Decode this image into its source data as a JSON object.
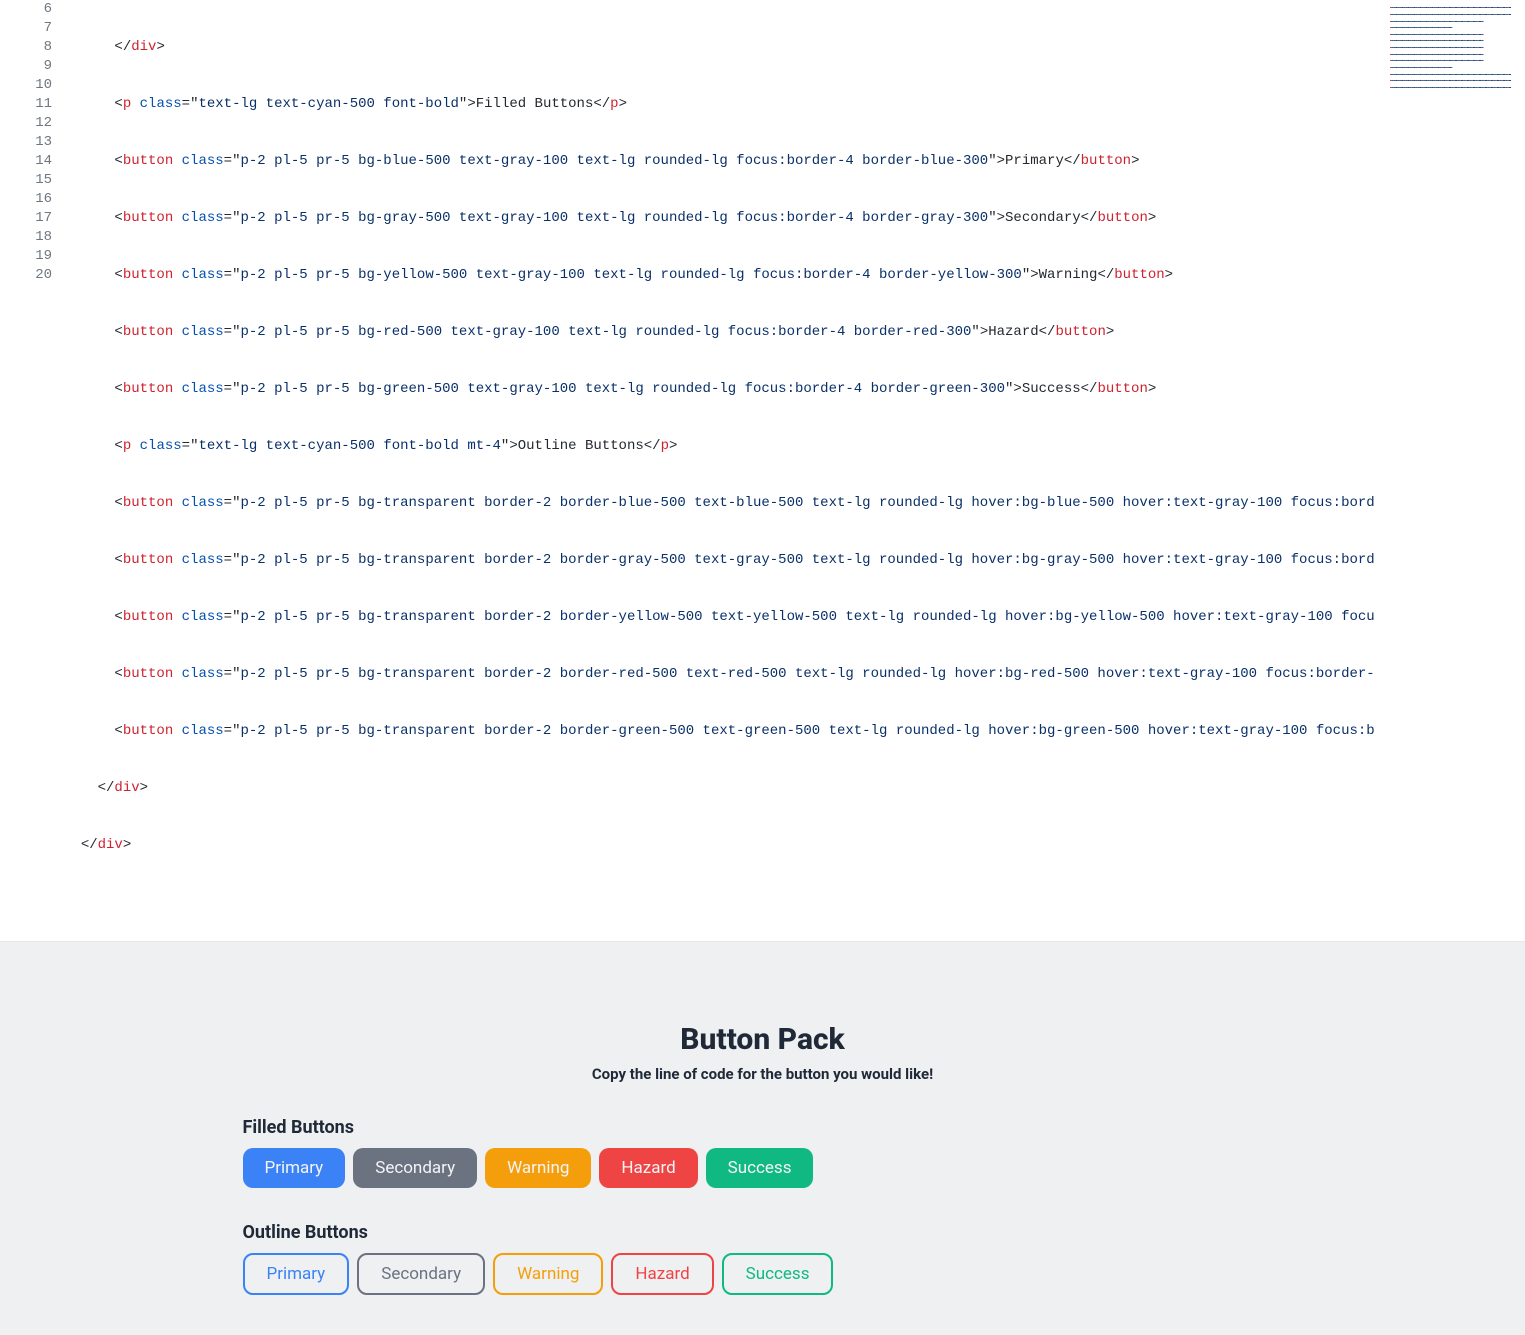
{
  "gutter": [
    "6",
    "7",
    "8",
    "9",
    "10",
    "11",
    "12",
    "13",
    "14",
    "15",
    "16",
    "17",
    "18",
    "19",
    "20"
  ],
  "code": {
    "l6": {
      "indent": "      ",
      "tag_open": "</",
      "tag": "div",
      "tag_close": ">"
    },
    "l7": {
      "indent": "      ",
      "open": "<",
      "tag": "p",
      "sp": " ",
      "attr": "class",
      "eq": "=",
      "q1": "\"",
      "val": "text-lg text-cyan-500 font-bold",
      "q2": "\"",
      "gt": ">",
      "txt": "Filled Buttons",
      "close_open": "</",
      "close_tag": "p",
      "close_gt": ">"
    },
    "l8": {
      "indent": "      ",
      "open": "<",
      "tag": "button",
      "sp": " ",
      "attr": "class",
      "eq": "=",
      "q1": "\"",
      "val": "p-2 pl-5 pr-5 bg-blue-500 text-gray-100 text-lg rounded-lg focus:border-4 border-blue-300",
      "q2": "\"",
      "gt": ">",
      "txt": "Primary",
      "close_open": "</",
      "close_tag": "button",
      "close_gt": ">"
    },
    "l9": {
      "indent": "      ",
      "open": "<",
      "tag": "button",
      "sp": " ",
      "attr": "class",
      "eq": "=",
      "q1": "\"",
      "val": "p-2 pl-5 pr-5 bg-gray-500 text-gray-100 text-lg rounded-lg focus:border-4 border-gray-300",
      "q2": "\"",
      "gt": ">",
      "txt": "Secondary",
      "close_open": "</",
      "close_tag": "button",
      "close_gt": ">"
    },
    "l10": {
      "indent": "      ",
      "open": "<",
      "tag": "button",
      "sp": " ",
      "attr": "class",
      "eq": "=",
      "q1": "\"",
      "val": "p-2 pl-5 pr-5 bg-yellow-500 text-gray-100 text-lg rounded-lg focus:border-4 border-yellow-300",
      "q2": "\"",
      "gt": ">",
      "txt": "Warning",
      "close_open": "</",
      "close_tag": "button",
      "close_gt": ">"
    },
    "l11": {
      "indent": "      ",
      "open": "<",
      "tag": "button",
      "sp": " ",
      "attr": "class",
      "eq": "=",
      "q1": "\"",
      "val": "p-2 pl-5 pr-5 bg-red-500 text-gray-100 text-lg rounded-lg focus:border-4 border-red-300",
      "q2": "\"",
      "gt": ">",
      "txt": "Hazard",
      "close_open": "</",
      "close_tag": "button",
      "close_gt": ">"
    },
    "l12": {
      "indent": "      ",
      "open": "<",
      "tag": "button",
      "sp": " ",
      "attr": "class",
      "eq": "=",
      "q1": "\"",
      "val": "p-2 pl-5 pr-5 bg-green-500 text-gray-100 text-lg rounded-lg focus:border-4 border-green-300",
      "q2": "\"",
      "gt": ">",
      "txt": "Success",
      "close_open": "</",
      "close_tag": "button",
      "close_gt": ">"
    },
    "l13": {
      "indent": "      ",
      "open": "<",
      "tag": "p",
      "sp": " ",
      "attr": "class",
      "eq": "=",
      "q1": "\"",
      "val": "text-lg text-cyan-500 font-bold mt-4",
      "q2": "\"",
      "gt": ">",
      "txt": "Outline Buttons",
      "close_open": "</",
      "close_tag": "p",
      "close_gt": ">"
    },
    "l14": {
      "indent": "      ",
      "open": "<",
      "tag": "button",
      "sp": " ",
      "attr": "class",
      "eq": "=",
      "q1": "\"",
      "val": "p-2 pl-5 pr-5 bg-transparent border-2 border-blue-500 text-blue-500 text-lg rounded-lg hover:bg-blue-500 hover:text-gray-100 focus:bord"
    },
    "l15": {
      "indent": "      ",
      "open": "<",
      "tag": "button",
      "sp": " ",
      "attr": "class",
      "eq": "=",
      "q1": "\"",
      "val": "p-2 pl-5 pr-5 bg-transparent border-2 border-gray-500 text-gray-500 text-lg rounded-lg hover:bg-gray-500 hover:text-gray-100 focus:bord"
    },
    "l16": {
      "indent": "      ",
      "open": "<",
      "tag": "button",
      "sp": " ",
      "attr": "class",
      "eq": "=",
      "q1": "\"",
      "val": "p-2 pl-5 pr-5 bg-transparent border-2 border-yellow-500 text-yellow-500 text-lg rounded-lg hover:bg-yellow-500 hover:text-gray-100 focu"
    },
    "l17": {
      "indent": "      ",
      "open": "<",
      "tag": "button",
      "sp": " ",
      "attr": "class",
      "eq": "=",
      "q1": "\"",
      "val": "p-2 pl-5 pr-5 bg-transparent border-2 border-red-500 text-red-500 text-lg rounded-lg hover:bg-red-500 hover:text-gray-100 focus:border-"
    },
    "l18": {
      "indent": "      ",
      "open": "<",
      "tag": "button",
      "sp": " ",
      "attr": "class",
      "eq": "=",
      "q1": "\"",
      "val": "p-2 pl-5 pr-5 bg-transparent border-2 border-green-500 text-green-500 text-lg rounded-lg hover:bg-green-500 hover:text-gray-100 focus:b"
    },
    "l19": {
      "indent": "    ",
      "tag_open": "</",
      "tag": "div",
      "tag_close": ">"
    },
    "l20": {
      "indent": "  ",
      "tag_open": "</",
      "tag": "div",
      "tag_close": ">"
    }
  },
  "preview": {
    "title": "Button Pack",
    "subtitle": "Copy the line of code for the button you would like!",
    "filled_heading": "Filled Buttons",
    "outline_heading": "Outline Buttons",
    "buttons": {
      "primary": "Primary",
      "secondary": "Secondary",
      "warning": "Warning",
      "hazard": "Hazard",
      "success": "Success"
    }
  }
}
